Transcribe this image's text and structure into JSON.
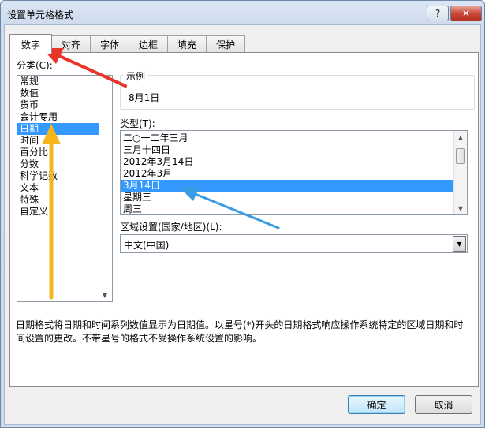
{
  "window": {
    "title": "设置单元格格式",
    "help_label": "?",
    "close_label": "✕"
  },
  "tabs": [
    {
      "label": "数字",
      "active": true
    },
    {
      "label": "对齐"
    },
    {
      "label": "字体"
    },
    {
      "label": "边框"
    },
    {
      "label": "填充"
    },
    {
      "label": "保护"
    }
  ],
  "category": {
    "label": "分类(C):",
    "items": [
      "常规",
      "数值",
      "货币",
      "会计专用",
      "日期",
      "时间",
      "百分比",
      "分数",
      "科学记数",
      "文本",
      "特殊",
      "自定义"
    ],
    "selected": "日期"
  },
  "sample": {
    "label": "示例",
    "value": "8月1日"
  },
  "type": {
    "label": "类型(T):",
    "items": [
      "二○一二年三月",
      "三月十四日",
      "2012年3月14日",
      "2012年3月",
      "3月14日",
      "星期三",
      "周三"
    ],
    "selected": "3月14日"
  },
  "locale": {
    "label": "区域设置(国家/地区)(L):",
    "value": "中文(中国)"
  },
  "description": {
    "line1": "日期格式将日期和时间系列数值显示为日期值。以星号(*)开头的日期格式响应操作系统特定的区域日期和时",
    "line2": "间设置的更改。不带星号的格式不受操作系统设置的影响。"
  },
  "buttons": {
    "ok": "确定",
    "cancel": "取消"
  },
  "colors": {
    "selection": "#3399ff",
    "annotation_red": "#e8352a",
    "annotation_yellow": "#f6b51c",
    "annotation_blue": "#3a9be5"
  }
}
